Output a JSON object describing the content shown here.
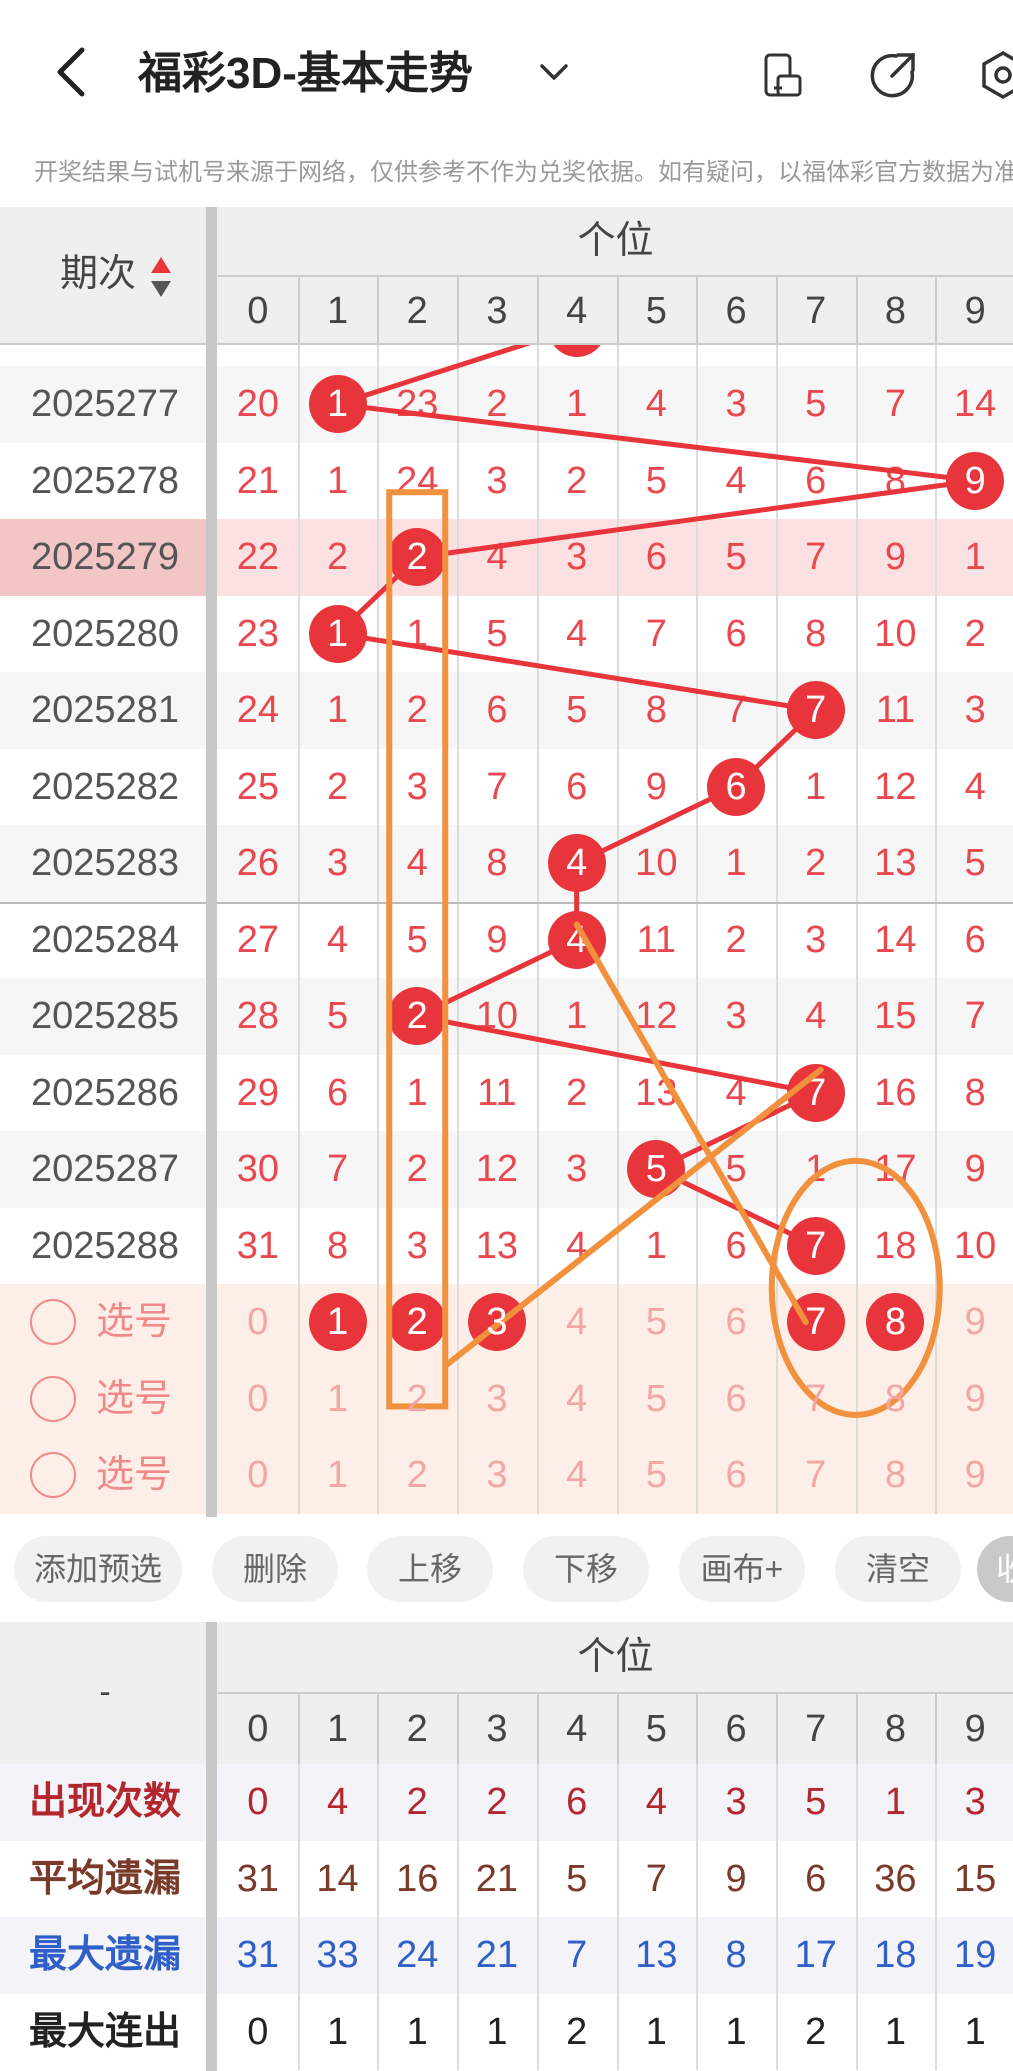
{
  "header": {
    "title": "福彩3D-基本走势",
    "notice": "开奖结果与试机号来源于网络，仅供参考不作为兑奖依据。如有疑问，以福体彩官方数据为准"
  },
  "table": {
    "issue_header": "期次",
    "position_header": "个位",
    "digits": [
      "0",
      "1",
      "2",
      "3",
      "4",
      "5",
      "6",
      "7",
      "8",
      "9"
    ],
    "partial_row_values": [
      "",
      "",
      "",
      "",
      "",
      "",
      "",
      "",
      "",
      ""
    ],
    "rows": [
      {
        "issue": "2025277",
        "values": [
          "20",
          "1",
          "23",
          "2",
          "1",
          "4",
          "3",
          "5",
          "7",
          "14"
        ],
        "hit": 1
      },
      {
        "issue": "2025278",
        "values": [
          "21",
          "1",
          "24",
          "3",
          "2",
          "5",
          "4",
          "6",
          "8",
          "9"
        ],
        "hit": 9
      },
      {
        "issue": "2025279",
        "values": [
          "22",
          "2",
          "2",
          "4",
          "3",
          "6",
          "5",
          "7",
          "9",
          "1"
        ],
        "hit": 2
      },
      {
        "issue": "2025280",
        "values": [
          "23",
          "1",
          "1",
          "5",
          "4",
          "7",
          "6",
          "8",
          "10",
          "2"
        ],
        "hit": 1
      },
      {
        "issue": "2025281",
        "values": [
          "24",
          "1",
          "2",
          "6",
          "5",
          "8",
          "7",
          "7",
          "11",
          "3"
        ],
        "hit": 7
      },
      {
        "issue": "2025282",
        "values": [
          "25",
          "2",
          "3",
          "7",
          "6",
          "9",
          "6",
          "1",
          "12",
          "4"
        ],
        "hit": 6
      },
      {
        "issue": "2025283",
        "values": [
          "26",
          "3",
          "4",
          "8",
          "4",
          "10",
          "1",
          "2",
          "13",
          "5"
        ],
        "hit": 4
      },
      {
        "issue": "2025284",
        "values": [
          "27",
          "4",
          "5",
          "9",
          "4",
          "11",
          "2",
          "3",
          "14",
          "6"
        ],
        "hit": 4
      },
      {
        "issue": "2025285",
        "values": [
          "28",
          "5",
          "2",
          "10",
          "1",
          "12",
          "3",
          "4",
          "15",
          "7"
        ],
        "hit": 2
      },
      {
        "issue": "2025286",
        "values": [
          "29",
          "6",
          "1",
          "11",
          "2",
          "13",
          "4",
          "7",
          "16",
          "8"
        ],
        "hit": 7
      },
      {
        "issue": "2025287",
        "values": [
          "30",
          "7",
          "2",
          "12",
          "3",
          "5",
          "5",
          "1",
          "17",
          "9"
        ],
        "hit": 5
      },
      {
        "issue": "2025288",
        "values": [
          "31",
          "8",
          "3",
          "13",
          "4",
          "1",
          "6",
          "7",
          "18",
          "10"
        ],
        "hit": 7
      }
    ],
    "select_rows": [
      {
        "label": "选号",
        "values": [
          "0",
          "1",
          "2",
          "3",
          "4",
          "5",
          "6",
          "7",
          "8",
          "9"
        ],
        "selected": [
          1,
          2,
          3,
          7,
          8
        ]
      },
      {
        "label": "选号",
        "values": [
          "0",
          "1",
          "2",
          "3",
          "4",
          "5",
          "6",
          "7",
          "8",
          "9"
        ],
        "selected": []
      },
      {
        "label": "选号",
        "values": [
          "0",
          "1",
          "2",
          "3",
          "4",
          "5",
          "6",
          "7",
          "8",
          "9"
        ],
        "selected": []
      }
    ]
  },
  "buttons": [
    "添加预选",
    "删除",
    "上移",
    "下移",
    "画布+",
    "清空",
    "收"
  ],
  "stats": {
    "corner": "-",
    "position_header": "个位",
    "digits": [
      "0",
      "1",
      "2",
      "3",
      "4",
      "5",
      "6",
      "7",
      "8",
      "9"
    ],
    "rows": [
      {
        "label": "出现次数",
        "values": [
          "0",
          "4",
          "2",
          "2",
          "6",
          "4",
          "3",
          "5",
          "1",
          "3"
        ],
        "color": "#b3262d",
        "label_color": "#b3262d"
      },
      {
        "label": "平均遗漏",
        "values": [
          "31",
          "14",
          "16",
          "21",
          "5",
          "7",
          "9",
          "6",
          "36",
          "15"
        ],
        "color": "#7a3a2a",
        "label_color": "#7a3a2a"
      },
      {
        "label": "最大遗漏",
        "values": [
          "31",
          "33",
          "24",
          "21",
          "7",
          "13",
          "8",
          "17",
          "18",
          "19"
        ],
        "color": "#2f5fc7",
        "label_color": "#2f5fc7"
      },
      {
        "label": "最大连出",
        "values": [
          "0",
          "1",
          "1",
          "1",
          "2",
          "1",
          "1",
          "2",
          "1",
          "1"
        ],
        "color": "#222",
        "label_color": "#222"
      }
    ]
  },
  "colors": {
    "hit": "#e8353b",
    "miss": "#e8484e",
    "orange": "#f2913d",
    "highlight_row": "#f3c6c6",
    "select_bg": "#fdeee8"
  }
}
